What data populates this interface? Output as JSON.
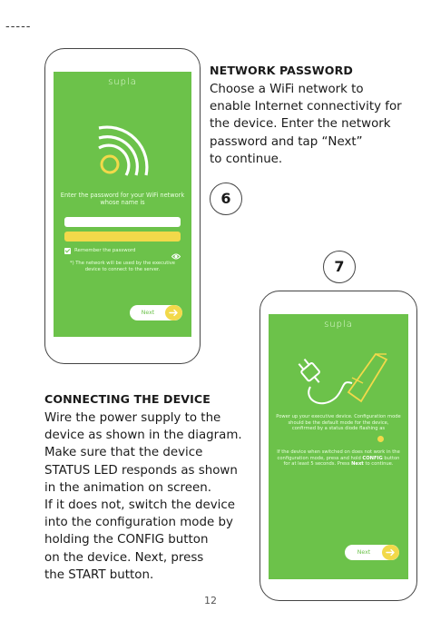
{
  "decoration": {
    "dashes": "-----"
  },
  "section_network": {
    "heading": "NETWORK PASSWORD",
    "body": "Choose a WiFi network to\nenable Internet connectivity for\nthe device. Enter the network\npassword and tap “Next”\nto continue.",
    "step_number": "6"
  },
  "section_connect": {
    "heading": "CONNECTING THE DEVICE",
    "body": "Wire the power supply to the\ndevice as shown in the diagram.\nMake sure that the device\nSTATUS LED responds as shown\nin the animation on screen.\nIf it does not, switch the device\ninto the configuration mode by\nholding the CONFIG button\non the device. Next, press\nthe START button.",
    "step_number": "7"
  },
  "phone_6": {
    "brand": "supla",
    "prompt": "Enter the password for your WiFi network whose name is",
    "remember_label": "Remember the password",
    "note": "*) The network will be used by the executive device to connect to the server.",
    "next_label": "Next",
    "icons": [
      "wifi-icon",
      "checkbox-icon",
      "eye-icon",
      "arrow-right-icon"
    ]
  },
  "phone_7": {
    "brand": "supla",
    "plug_label": "POWER",
    "text_1": "Power up your executive device. Configuration mode should be the default mode for the device, confirmed by a status diode flashing as",
    "text_2_pre": "If the device when switched on does not work in the configuration mode, press and hold",
    "text_2_config": "CONFIG",
    "text_2_mid": "button for at least 5 seconds. Press",
    "text_2_next": "Next",
    "text_2_post": "to continue.",
    "next_label": "Next",
    "icons": [
      "plug-icon",
      "status-led-icon",
      "arrow-right-icon"
    ]
  },
  "colors": {
    "screen_green": "#6cc24a",
    "accent_yellow": "#f2d94a",
    "text_dark": "#1a1a1a"
  },
  "page_number": "12"
}
